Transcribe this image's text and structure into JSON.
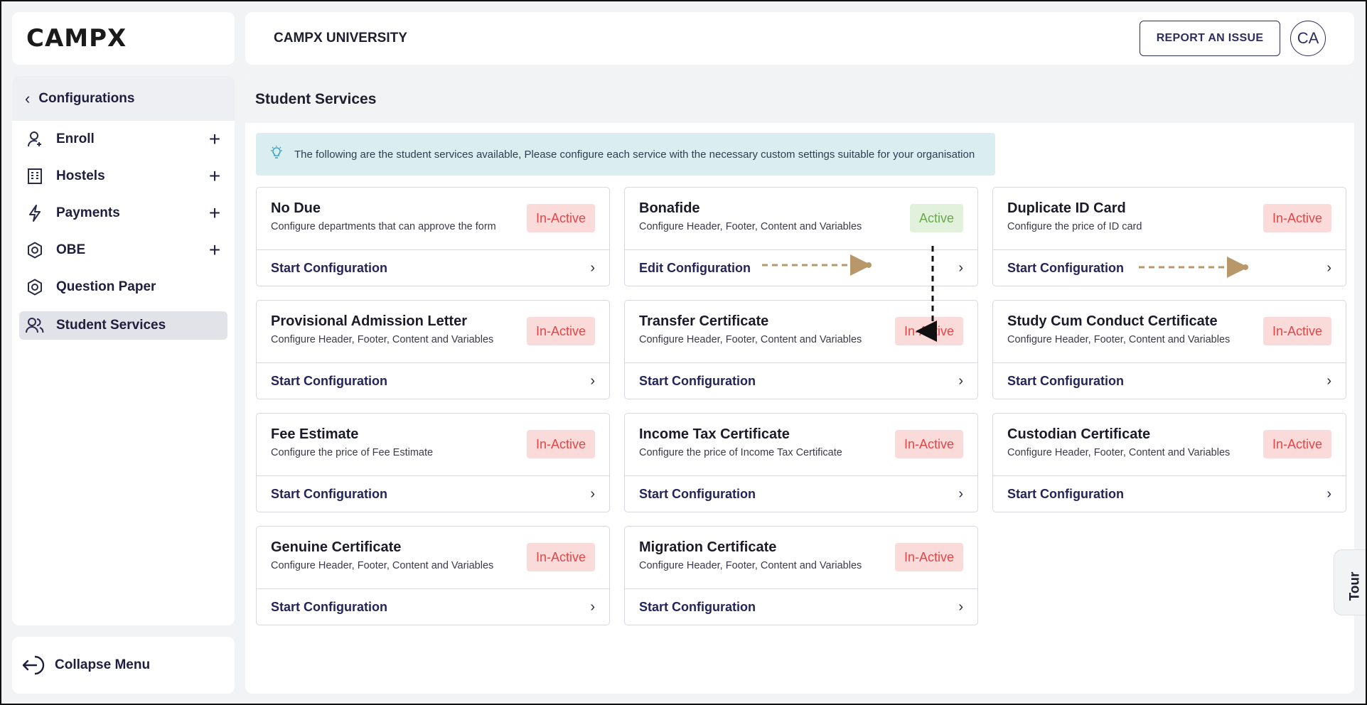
{
  "brand": {
    "logo_text": "CAMPX"
  },
  "header": {
    "university": "CAMPX UNIVERSITY",
    "report_label": "REPORT AN ISSUE",
    "avatar_initials": "CA"
  },
  "sidebar": {
    "back_label": "Configurations",
    "items": [
      {
        "label": "Enroll",
        "icon": "user-plus-icon",
        "expandable": true
      },
      {
        "label": "Hostels",
        "icon": "building-icon",
        "expandable": true
      },
      {
        "label": "Payments",
        "icon": "lightning-icon",
        "expandable": true
      },
      {
        "label": "OBE",
        "icon": "hexagon-gear-icon",
        "expandable": true
      },
      {
        "label": "Question Paper",
        "icon": "hexagon-gear-icon",
        "expandable": false
      },
      {
        "label": "Student Services",
        "icon": "users-icon",
        "expandable": false,
        "active": true
      }
    ],
    "collapse_label": "Collapse Menu"
  },
  "main": {
    "title": "Student Services",
    "info": "The following are the student services available, Please configure each service with the necessary custom settings suitable for your organisation",
    "cards": [
      {
        "title": "No Due",
        "desc": "Configure departments that can approve the form",
        "status": "In-Active",
        "action": "Start Configuration"
      },
      {
        "title": "Bonafide",
        "desc": "Configure Header, Footer, Content and Variables",
        "status": "Active",
        "action": "Edit Configuration"
      },
      {
        "title": "Duplicate ID Card",
        "desc": "Configure the price of ID card",
        "status": "In-Active",
        "action": "Start Configuration"
      },
      {
        "title": "Provisional Admission Letter",
        "desc": "Configure Header, Footer, Content and Variables",
        "status": "In-Active",
        "action": "Start Configuration"
      },
      {
        "title": "Transfer Certificate",
        "desc": "Configure Header, Footer, Content and Variables",
        "status": "In-Active",
        "action": "Start Configuration"
      },
      {
        "title": "Study Cum Conduct Certificate",
        "desc": "Configure Header, Footer, Content and Variables",
        "status": "In-Active",
        "action": "Start Configuration"
      },
      {
        "title": "Fee Estimate",
        "desc": "Configure the price of Fee Estimate",
        "status": "In-Active",
        "action": "Start Configuration"
      },
      {
        "title": "Income Tax Certificate",
        "desc": "Configure the price of Income Tax Certificate",
        "status": "In-Active",
        "action": "Start Configuration"
      },
      {
        "title": "Custodian Certificate",
        "desc": "Configure Header, Footer, Content and Variables",
        "status": "In-Active",
        "action": "Start Configuration"
      },
      {
        "title": "Genuine Certificate",
        "desc": "Configure Header, Footer, Content and Variables",
        "status": "In-Active",
        "action": "Start Configuration"
      },
      {
        "title": "Migration Certificate",
        "desc": "Configure Header, Footer, Content and Variables",
        "status": "In-Active",
        "action": "Start Configuration"
      }
    ]
  },
  "tour_label": "Tour",
  "colors": {
    "inactive": "#e04848",
    "active": "#6aa84f",
    "accent": "#24245a"
  }
}
